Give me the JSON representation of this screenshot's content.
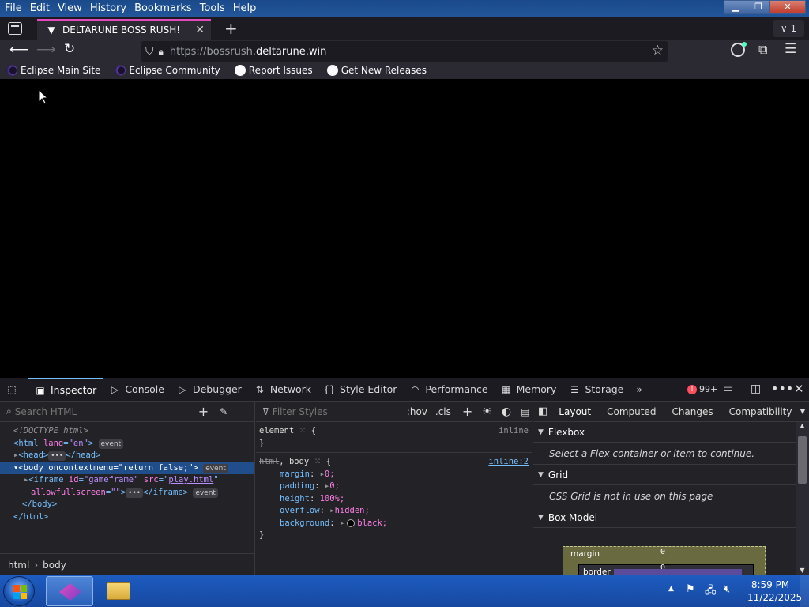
{
  "menu": [
    "File",
    "Edit",
    "View",
    "History",
    "Bookmarks",
    "Tools",
    "Help"
  ],
  "tab": {
    "title": "DELTARUNE BOSS RUSH!",
    "close": "✕",
    "new_tab": "+",
    "list_count": "1"
  },
  "url": {
    "prefix": "https://bossrush.",
    "domain": "deltarune.win"
  },
  "bookmarks": [
    "Eclipse Main Site",
    "Eclipse Community",
    "Report Issues",
    "Get New Releases"
  ],
  "devtools": {
    "tabs": [
      "Inspector",
      "Console",
      "Debugger",
      "Network",
      "Style Editor",
      "Performance",
      "Memory",
      "Storage"
    ],
    "error_count": "99+",
    "search_placeholder": "Search HTML",
    "filter_placeholder": "Filter Styles",
    "hov": ":hov",
    "cls": ".cls",
    "html_tree": {
      "doctype": "<!DOCTYPE html>",
      "html_open_tag": "<html",
      "html_attr": "lang",
      "html_attr_val": "\"en\"",
      "event": "event",
      "head": "<head>",
      "head_close": "</head>",
      "body_open": "<body",
      "body_attr": "oncontextmenu",
      "body_attr_val": "\"return false;\"",
      "iframe_open": "<iframe",
      "iframe_id_attr": "id",
      "iframe_id_val": "\"gameframe\"",
      "iframe_src_attr": "src",
      "iframe_src_val": "play.html",
      "iframe_afs": "allowfullscreen",
      "iframe_afs_val": "\"\"",
      "iframe_close": "</iframe>",
      "body_close": "</body>",
      "html_close": "</html>"
    },
    "breadcrumbs": [
      "html",
      "body"
    ],
    "rules": {
      "element_selector": "element",
      "inline_label": "inline",
      "rule2_selector_struck": "html",
      "rule2_selector": ", body",
      "rule2_source": "inline:2",
      "props": [
        {
          "name": "margin",
          "value": "0;"
        },
        {
          "name": "padding",
          "value": "0;"
        },
        {
          "name": "height",
          "value": "100%;"
        },
        {
          "name": "overflow",
          "value": "hidden;"
        },
        {
          "name": "background",
          "value": "black;"
        }
      ]
    },
    "layout_tabs": [
      "Layout",
      "Computed",
      "Changes",
      "Compatibility"
    ],
    "flexbox": {
      "title": "Flexbox",
      "msg": "Select a Flex container or item to continue."
    },
    "grid": {
      "title": "Grid",
      "msg": "CSS Grid is not in use on this page"
    },
    "box_model": {
      "title": "Box Model",
      "margin_label": "margin",
      "margin_val": "0",
      "border_label": "border",
      "border_val": "0"
    }
  },
  "taskbar": {
    "time": "8:59 PM",
    "date": "11/22/2025"
  },
  "colors": {
    "accent": "#e04cbf",
    "devtools_blue": "#75bfff",
    "selected_row": "#204e8a",
    "error_red": "#ff4f5e"
  }
}
